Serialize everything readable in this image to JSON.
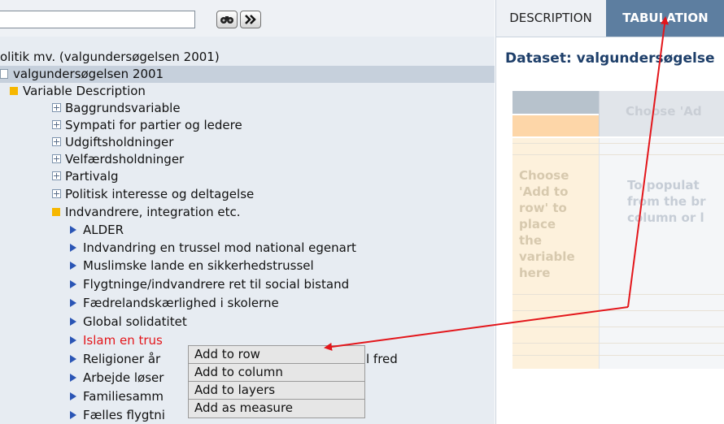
{
  "toolbar": {
    "search_value": "",
    "find_icon": "binoculars-icon",
    "next_icon": "double-chevron-right-icon"
  },
  "tree": {
    "root": "olitik mv. (valgundersøgelsen 2001)",
    "dataset": "valgundersøgelsen 2001",
    "section": "Variable Description",
    "groups": [
      "Baggrundsvariable",
      "Sympati for partier og ledere",
      "Udgiftsholdninger",
      "Velfærdsholdninger",
      "Partivalg",
      "Politisk interesse og deltagelse"
    ],
    "open_group": "Indvandrere, integration etc.",
    "variables": [
      "ALDER",
      "Indvandring en trussel mod national egenart",
      "Muslimske lande en sikkerhedstrussel",
      "Flygtninge/indvandrere ret til social bistand",
      "Fædrelandskærlighed i skolerne",
      "Global solidatitet",
      "Islam en trus",
      "Religioner år",
      "Arbejde løser",
      "Familiesamm",
      "Fælles flygtni"
    ],
    "variable_tails": {
      "religion": "l fred"
    }
  },
  "context_menu": {
    "items": [
      "Add to row",
      "Add to column",
      "Add to layers",
      "Add as measure"
    ]
  },
  "right": {
    "tabs": [
      "DESCRIPTION",
      "TABULATION"
    ],
    "dataset_label": "Dataset: valgundersøgelse",
    "col_placeholder": "Choose 'Ad",
    "row_placeholder": "Choose\n'Add to\nrow' to\nplace\nthe\nvariable\nhere",
    "body_placeholder": "To populat\nfrom the br\ncolumn or l"
  },
  "colors": {
    "accent": "#5d7ea0",
    "highlight_red": "#e3161b",
    "folder_orange": "#f6b700",
    "arrow_red": "#e3161b"
  }
}
